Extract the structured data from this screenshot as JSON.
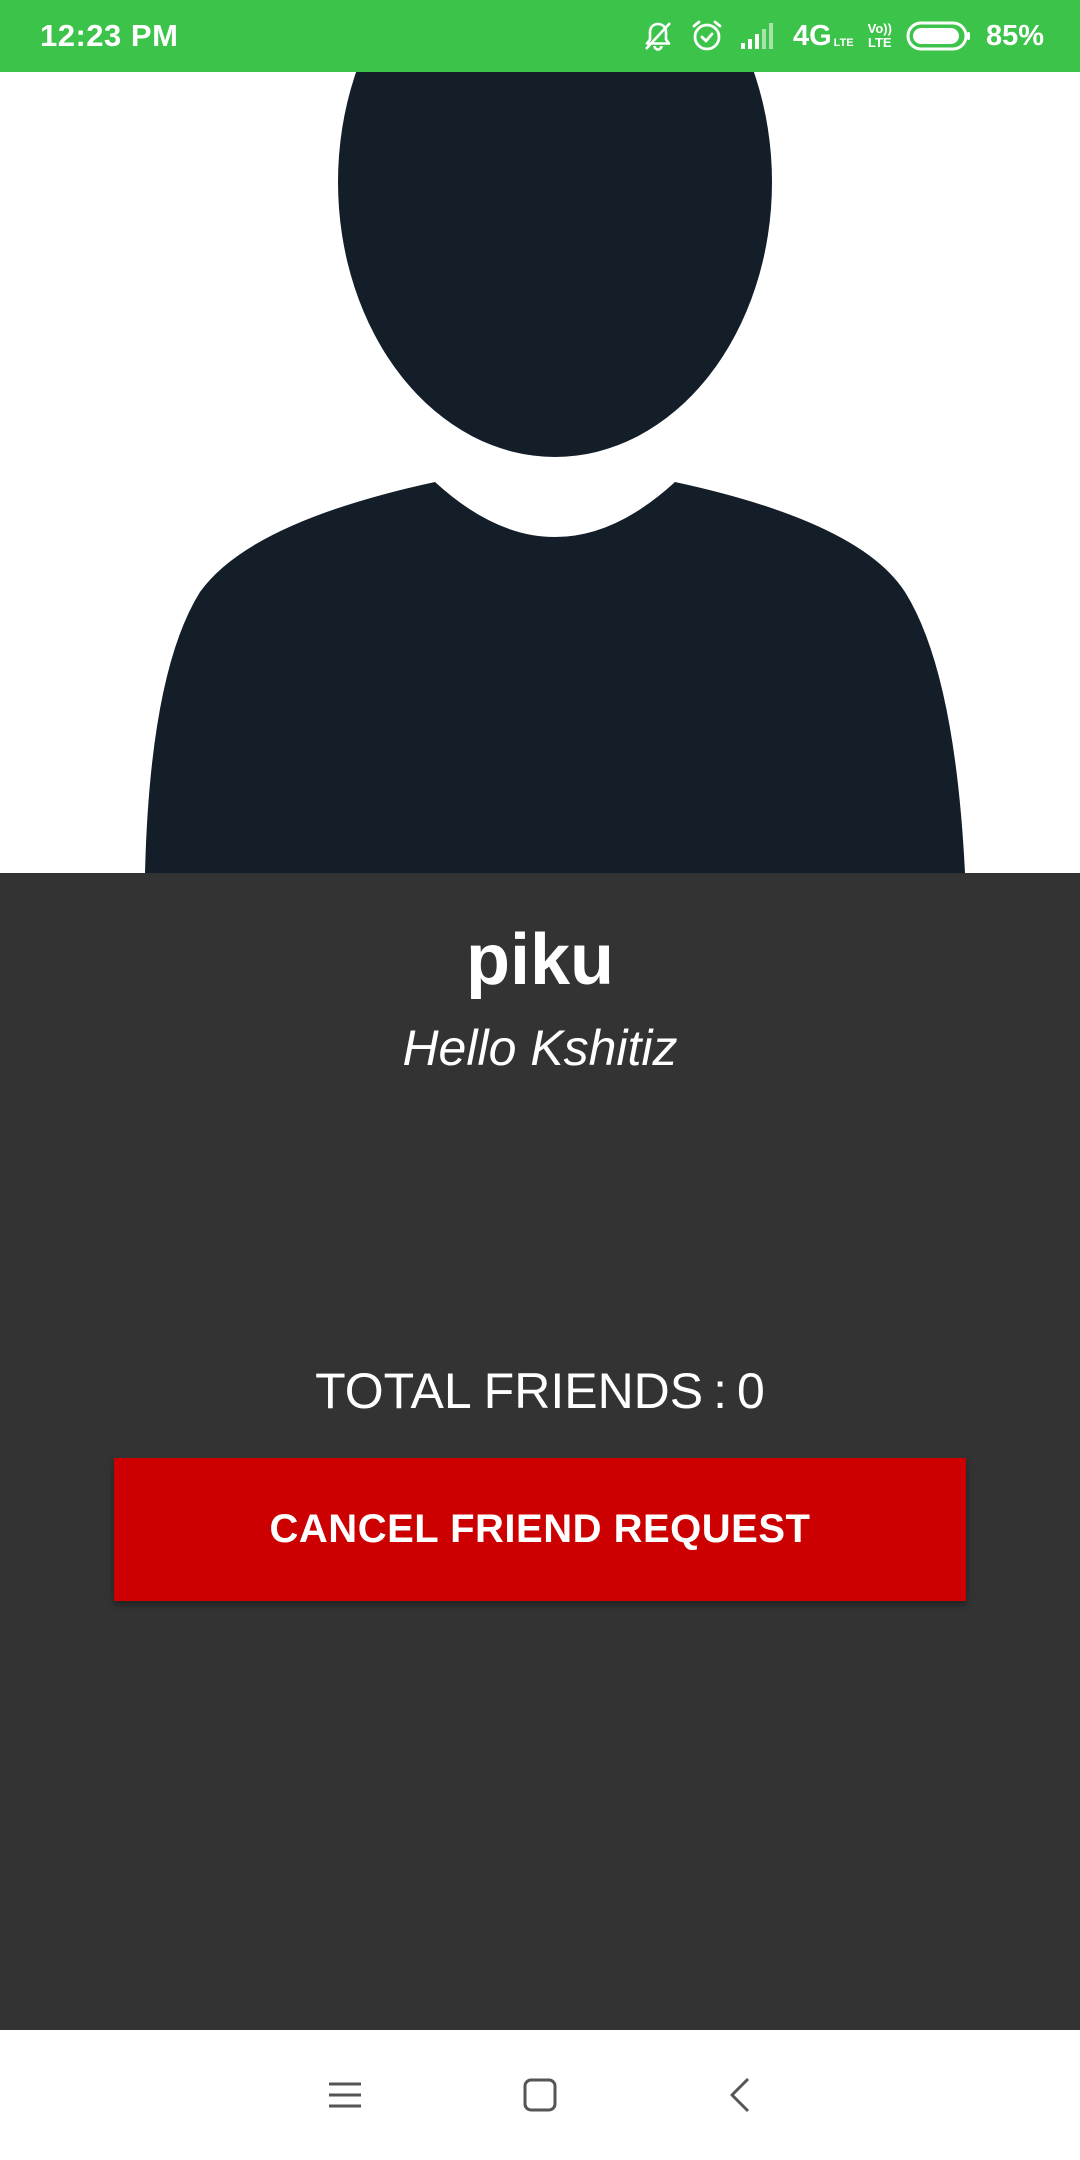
{
  "status_bar": {
    "time": "12:23 PM",
    "network": "4G",
    "network_sub": "LTE",
    "volte_top": "Vo))",
    "volte_bottom": "LTE",
    "battery": "85%",
    "background": "#3cc34a",
    "icons": [
      "mute-bell-icon",
      "alarm-icon",
      "signal-icon",
      "volte-icon",
      "battery-icon"
    ]
  },
  "profile": {
    "avatar_icon": "default-avatar-silhouette-icon",
    "name": "piku",
    "status": "Hello Kshitiz",
    "friends_label": "TOTAL FRIENDS",
    "friends_separator": ":",
    "friends_count": "0"
  },
  "actions": {
    "cancel_request_label": "CANCEL FRIEND REQUEST",
    "button_color": "#cc0000"
  },
  "nav_bar": {
    "icons": [
      "menu-icon",
      "home-square-icon",
      "back-chevron-icon"
    ]
  },
  "colors": {
    "background": "#333333",
    "avatar_fill": "#141e29",
    "text": "#ffffff"
  }
}
